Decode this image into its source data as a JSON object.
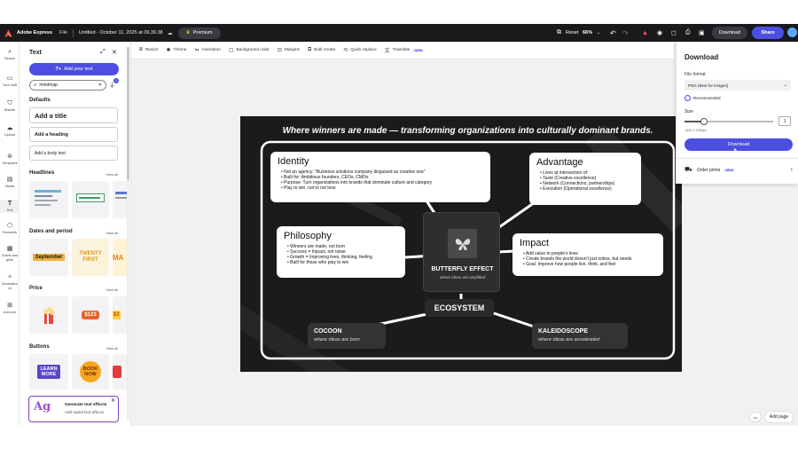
{
  "topbar": {
    "app_name": "Adobe Express",
    "file_menu": "File",
    "doc_title": "Untitled - October 11, 2025 at 09.39.38",
    "premium": "Premium",
    "reset": "Reset",
    "zoom": "66%",
    "download": "Download",
    "share": "Share"
  },
  "rail": {
    "items": [
      "Search",
      "Your stuff",
      "Brands",
      "Upload",
      "Templates",
      "Media",
      "Text",
      "Elements",
      "Charts and grids",
      "Generative AI",
      "Add-ons"
    ]
  },
  "panel": {
    "title": "Text",
    "add_text": "Add your text",
    "search_value": "mindmap",
    "filter_badge": "1",
    "defaults_title": "Defaults",
    "add_title": "Add a title",
    "add_heading": "Add a heading",
    "add_body": "Add a body text",
    "headlines_title": "Headlines",
    "dates_title": "Dates and period",
    "price_title": "Price",
    "buttons_title": "Buttons",
    "view_all": "View all",
    "date_thumb_1": "September",
    "date_thumb_2": "TWENTY FIRST",
    "date_thumb_3": "MA",
    "price_thumb_2": "$123",
    "price_thumb_3": "$2",
    "btn_thumb_1": "LEARN MORE",
    "btn_thumb_2": "BOOK NOW",
    "promo_title": "Generate text effects",
    "promo_sub": "Add styled text effects",
    "promo_glyph": "Ag"
  },
  "toolbar": {
    "items": [
      "Resize",
      "Theme",
      "Animation",
      "Background color",
      "Margins",
      "Bulk create",
      "Quick replace",
      "Translate"
    ],
    "new_badge": "NEW"
  },
  "canvas": {
    "headline": "Where winners are made — transforming organizations into culturally dominant brands.",
    "identity": {
      "title": "Identity",
      "bullets": [
        "• Not an agency: \"Business solutions company disguised as creative one\"",
        "• Built for: Ambitious founders, CEOs, CMOs",
        "• Purpose: Turn organizations into brands that dominate culture and category",
        "• Play to win, not to not lose"
      ]
    },
    "advantage": {
      "title": "Advantage",
      "bullets": [
        "• Lives at intersection of:",
        "• Taste (Creative excellence)",
        "• Network (Connections, partnerships)",
        "• Execution (Operational excellence)"
      ]
    },
    "philosophy": {
      "title": "Philosophy",
      "bullets": [
        "• Winners are made, not born",
        "• Success = Impact, not noise",
        "• Growth = Improving lives, thinking, feeling",
        "• Built for those who play to win"
      ]
    },
    "impact": {
      "title": "Impact",
      "bullets": [
        "• Add value to people's lives",
        "• Create brands the world doesn't just notice, but needs",
        "• Goal: Improve how people live, think, and feel"
      ]
    },
    "center": {
      "title": "BUTTERFLY EFFECT",
      "subtitle": "where ideas are amplified"
    },
    "ecosystem": "ECOSYSTEM",
    "cocoon": {
      "title": "COCOON",
      "subtitle": "where ideas are born"
    },
    "kaleidoscope": {
      "title": "KALEIDOSCOPE",
      "subtitle": "where ideas are accelerated"
    }
  },
  "download_panel": {
    "title": "Download",
    "format_label": "File format",
    "format_value": "PNG (Best for images)",
    "recommended": "Recommended",
    "size_label": "Size",
    "size_value": "1",
    "dimensions": "1920 x 1080px",
    "download_btn": "Download",
    "order_prints": "Order prints",
    "new_badge": "NEW"
  },
  "bottom": {
    "more": "•••",
    "add_page": "Add page"
  },
  "colors": {
    "accent": "#4b4ee0",
    "topbar": "#1a1a1c",
    "canvas_bg": "#1b1b1b"
  }
}
